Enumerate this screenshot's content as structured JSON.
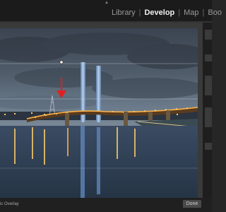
{
  "modules": {
    "items": [
      "Library",
      "Develop",
      "Map",
      "Boo"
    ],
    "active": "Develop"
  },
  "photo": {
    "annotation_color": "#e02020"
  },
  "bottom": {
    "overlay_label": "ic Overlay",
    "done_label": "Done"
  }
}
